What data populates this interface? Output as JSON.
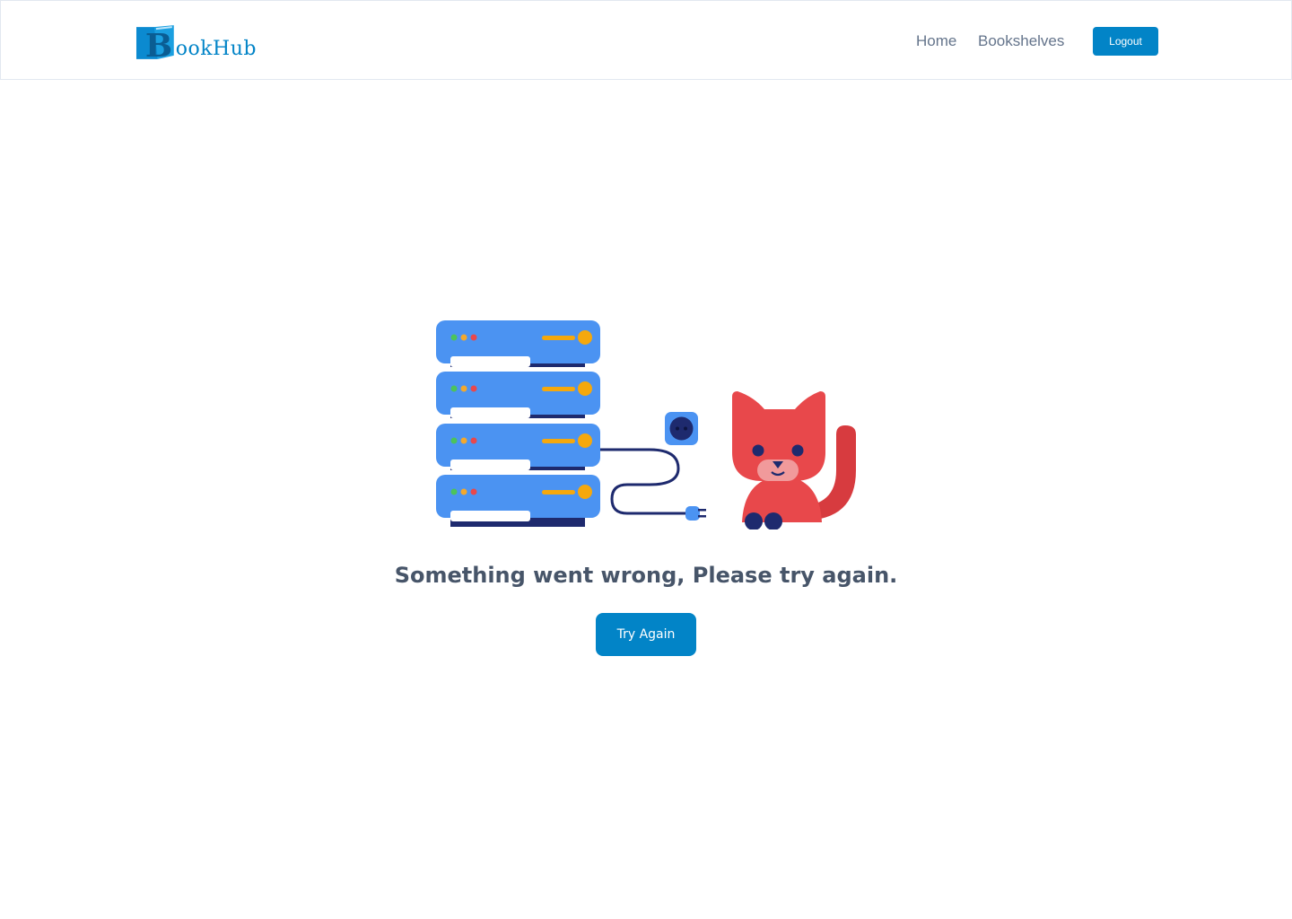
{
  "app": {
    "logo_text": "ookHub",
    "logo_letter": "B",
    "brand_color": "#0284c7"
  },
  "nav": {
    "items": [
      {
        "label": "Home"
      },
      {
        "label": "Bookshelves"
      }
    ],
    "logout_label": "Logout"
  },
  "error": {
    "illustration_icon": "server-disconnected-cat-illustration",
    "message": "Something went wrong, Please try again.",
    "retry_label": "Try Again"
  }
}
